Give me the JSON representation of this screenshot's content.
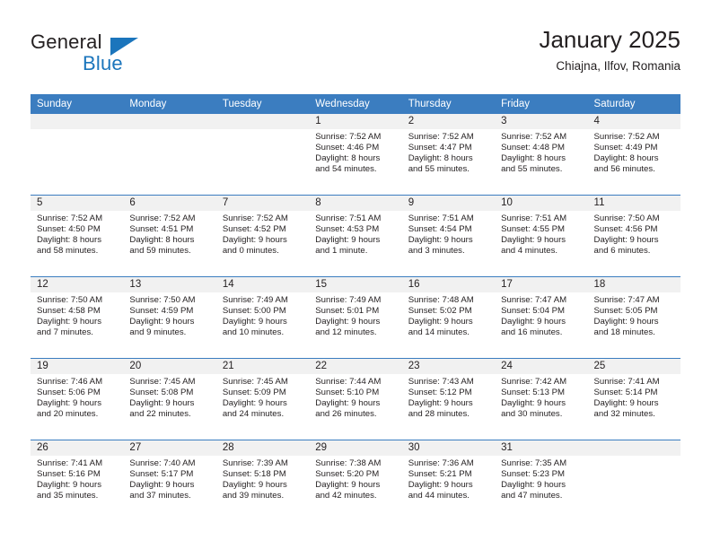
{
  "brand": {
    "name_part1": "General",
    "name_part2": "Blue",
    "accent_color": "#1b75bc",
    "triangle_icon": "triangle-icon"
  },
  "header": {
    "title": "January 2025",
    "location": "Chiajna, Ilfov, Romania"
  },
  "theme": {
    "header_bg": "#3b7dc0",
    "daynum_band_bg": "#f1f1f1",
    "text_color": "#231f20"
  },
  "weekday_headers": [
    "Sunday",
    "Monday",
    "Tuesday",
    "Wednesday",
    "Thursday",
    "Friday",
    "Saturday"
  ],
  "weeks": [
    [
      {
        "day": "",
        "sunrise": "",
        "sunset": "",
        "daylight_line1": "",
        "daylight_line2": ""
      },
      {
        "day": "",
        "sunrise": "",
        "sunset": "",
        "daylight_line1": "",
        "daylight_line2": ""
      },
      {
        "day": "",
        "sunrise": "",
        "sunset": "",
        "daylight_line1": "",
        "daylight_line2": ""
      },
      {
        "day": "1",
        "sunrise": "Sunrise: 7:52 AM",
        "sunset": "Sunset: 4:46 PM",
        "daylight_line1": "Daylight: 8 hours",
        "daylight_line2": "and 54 minutes."
      },
      {
        "day": "2",
        "sunrise": "Sunrise: 7:52 AM",
        "sunset": "Sunset: 4:47 PM",
        "daylight_line1": "Daylight: 8 hours",
        "daylight_line2": "and 55 minutes."
      },
      {
        "day": "3",
        "sunrise": "Sunrise: 7:52 AM",
        "sunset": "Sunset: 4:48 PM",
        "daylight_line1": "Daylight: 8 hours",
        "daylight_line2": "and 55 minutes."
      },
      {
        "day": "4",
        "sunrise": "Sunrise: 7:52 AM",
        "sunset": "Sunset: 4:49 PM",
        "daylight_line1": "Daylight: 8 hours",
        "daylight_line2": "and 56 minutes."
      }
    ],
    [
      {
        "day": "5",
        "sunrise": "Sunrise: 7:52 AM",
        "sunset": "Sunset: 4:50 PM",
        "daylight_line1": "Daylight: 8 hours",
        "daylight_line2": "and 58 minutes."
      },
      {
        "day": "6",
        "sunrise": "Sunrise: 7:52 AM",
        "sunset": "Sunset: 4:51 PM",
        "daylight_line1": "Daylight: 8 hours",
        "daylight_line2": "and 59 minutes."
      },
      {
        "day": "7",
        "sunrise": "Sunrise: 7:52 AM",
        "sunset": "Sunset: 4:52 PM",
        "daylight_line1": "Daylight: 9 hours",
        "daylight_line2": "and 0 minutes."
      },
      {
        "day": "8",
        "sunrise": "Sunrise: 7:51 AM",
        "sunset": "Sunset: 4:53 PM",
        "daylight_line1": "Daylight: 9 hours",
        "daylight_line2": "and 1 minute."
      },
      {
        "day": "9",
        "sunrise": "Sunrise: 7:51 AM",
        "sunset": "Sunset: 4:54 PM",
        "daylight_line1": "Daylight: 9 hours",
        "daylight_line2": "and 3 minutes."
      },
      {
        "day": "10",
        "sunrise": "Sunrise: 7:51 AM",
        "sunset": "Sunset: 4:55 PM",
        "daylight_line1": "Daylight: 9 hours",
        "daylight_line2": "and 4 minutes."
      },
      {
        "day": "11",
        "sunrise": "Sunrise: 7:50 AM",
        "sunset": "Sunset: 4:56 PM",
        "daylight_line1": "Daylight: 9 hours",
        "daylight_line2": "and 6 minutes."
      }
    ],
    [
      {
        "day": "12",
        "sunrise": "Sunrise: 7:50 AM",
        "sunset": "Sunset: 4:58 PM",
        "daylight_line1": "Daylight: 9 hours",
        "daylight_line2": "and 7 minutes."
      },
      {
        "day": "13",
        "sunrise": "Sunrise: 7:50 AM",
        "sunset": "Sunset: 4:59 PM",
        "daylight_line1": "Daylight: 9 hours",
        "daylight_line2": "and 9 minutes."
      },
      {
        "day": "14",
        "sunrise": "Sunrise: 7:49 AM",
        "sunset": "Sunset: 5:00 PM",
        "daylight_line1": "Daylight: 9 hours",
        "daylight_line2": "and 10 minutes."
      },
      {
        "day": "15",
        "sunrise": "Sunrise: 7:49 AM",
        "sunset": "Sunset: 5:01 PM",
        "daylight_line1": "Daylight: 9 hours",
        "daylight_line2": "and 12 minutes."
      },
      {
        "day": "16",
        "sunrise": "Sunrise: 7:48 AM",
        "sunset": "Sunset: 5:02 PM",
        "daylight_line1": "Daylight: 9 hours",
        "daylight_line2": "and 14 minutes."
      },
      {
        "day": "17",
        "sunrise": "Sunrise: 7:47 AM",
        "sunset": "Sunset: 5:04 PM",
        "daylight_line1": "Daylight: 9 hours",
        "daylight_line2": "and 16 minutes."
      },
      {
        "day": "18",
        "sunrise": "Sunrise: 7:47 AM",
        "sunset": "Sunset: 5:05 PM",
        "daylight_line1": "Daylight: 9 hours",
        "daylight_line2": "and 18 minutes."
      }
    ],
    [
      {
        "day": "19",
        "sunrise": "Sunrise: 7:46 AM",
        "sunset": "Sunset: 5:06 PM",
        "daylight_line1": "Daylight: 9 hours",
        "daylight_line2": "and 20 minutes."
      },
      {
        "day": "20",
        "sunrise": "Sunrise: 7:45 AM",
        "sunset": "Sunset: 5:08 PM",
        "daylight_line1": "Daylight: 9 hours",
        "daylight_line2": "and 22 minutes."
      },
      {
        "day": "21",
        "sunrise": "Sunrise: 7:45 AM",
        "sunset": "Sunset: 5:09 PM",
        "daylight_line1": "Daylight: 9 hours",
        "daylight_line2": "and 24 minutes."
      },
      {
        "day": "22",
        "sunrise": "Sunrise: 7:44 AM",
        "sunset": "Sunset: 5:10 PM",
        "daylight_line1": "Daylight: 9 hours",
        "daylight_line2": "and 26 minutes."
      },
      {
        "day": "23",
        "sunrise": "Sunrise: 7:43 AM",
        "sunset": "Sunset: 5:12 PM",
        "daylight_line1": "Daylight: 9 hours",
        "daylight_line2": "and 28 minutes."
      },
      {
        "day": "24",
        "sunrise": "Sunrise: 7:42 AM",
        "sunset": "Sunset: 5:13 PM",
        "daylight_line1": "Daylight: 9 hours",
        "daylight_line2": "and 30 minutes."
      },
      {
        "day": "25",
        "sunrise": "Sunrise: 7:41 AM",
        "sunset": "Sunset: 5:14 PM",
        "daylight_line1": "Daylight: 9 hours",
        "daylight_line2": "and 32 minutes."
      }
    ],
    [
      {
        "day": "26",
        "sunrise": "Sunrise: 7:41 AM",
        "sunset": "Sunset: 5:16 PM",
        "daylight_line1": "Daylight: 9 hours",
        "daylight_line2": "and 35 minutes."
      },
      {
        "day": "27",
        "sunrise": "Sunrise: 7:40 AM",
        "sunset": "Sunset: 5:17 PM",
        "daylight_line1": "Daylight: 9 hours",
        "daylight_line2": "and 37 minutes."
      },
      {
        "day": "28",
        "sunrise": "Sunrise: 7:39 AM",
        "sunset": "Sunset: 5:18 PM",
        "daylight_line1": "Daylight: 9 hours",
        "daylight_line2": "and 39 minutes."
      },
      {
        "day": "29",
        "sunrise": "Sunrise: 7:38 AM",
        "sunset": "Sunset: 5:20 PM",
        "daylight_line1": "Daylight: 9 hours",
        "daylight_line2": "and 42 minutes."
      },
      {
        "day": "30",
        "sunrise": "Sunrise: 7:36 AM",
        "sunset": "Sunset: 5:21 PM",
        "daylight_line1": "Daylight: 9 hours",
        "daylight_line2": "and 44 minutes."
      },
      {
        "day": "31",
        "sunrise": "Sunrise: 7:35 AM",
        "sunset": "Sunset: 5:23 PM",
        "daylight_line1": "Daylight: 9 hours",
        "daylight_line2": "and 47 minutes."
      },
      {
        "day": "",
        "sunrise": "",
        "sunset": "",
        "daylight_line1": "",
        "daylight_line2": ""
      }
    ]
  ]
}
